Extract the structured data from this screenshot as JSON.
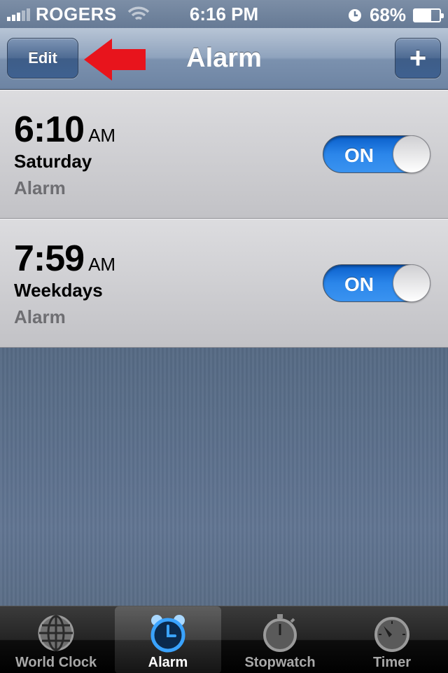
{
  "status_bar": {
    "carrier": "ROGERS",
    "time": "6:16 PM",
    "battery": "68%",
    "battery_level": 0.68,
    "icons": [
      "signal-icon",
      "wifi-icon",
      "alarm-clock-icon",
      "battery-icon"
    ]
  },
  "nav": {
    "edit_label": "Edit",
    "title": "Alarm",
    "add_label": "+"
  },
  "alarms": [
    {
      "time": "6:10",
      "ampm": "AM",
      "repeat": "Saturday",
      "label": "Alarm",
      "toggle": "ON"
    },
    {
      "time": "7:59",
      "ampm": "AM",
      "repeat": "Weekdays",
      "label": "Alarm",
      "toggle": "ON"
    }
  ],
  "tabs": [
    {
      "label": "World Clock",
      "icon": "globe-icon",
      "active": false
    },
    {
      "label": "Alarm",
      "icon": "alarm-clock-icon",
      "active": true
    },
    {
      "label": "Stopwatch",
      "icon": "stopwatch-icon",
      "active": false
    },
    {
      "label": "Timer",
      "icon": "timer-icon",
      "active": false
    }
  ],
  "colors": {
    "annotation_arrow": "#e8141c",
    "toggle_on": "#2b86ea",
    "active_tab_icon": "#3aa3ff"
  }
}
